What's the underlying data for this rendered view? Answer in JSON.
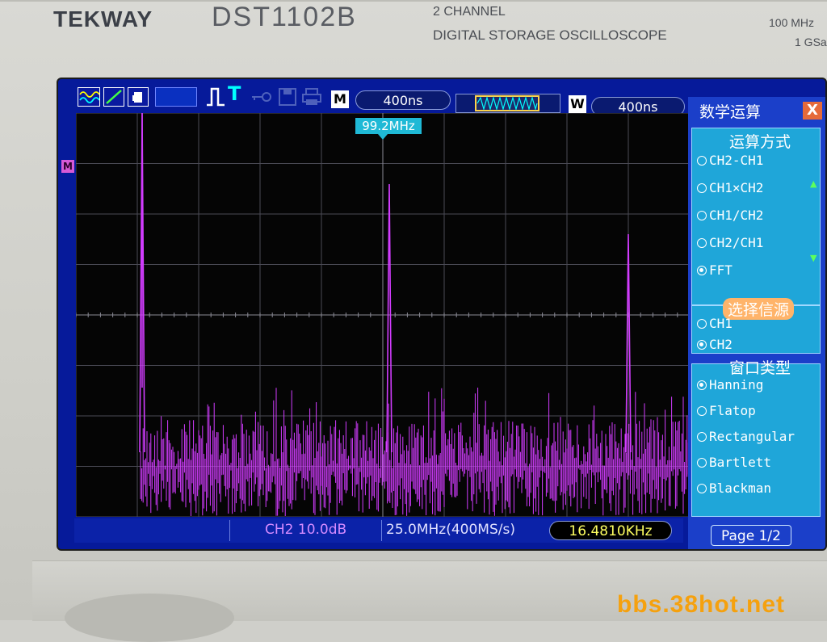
{
  "bezel": {
    "brand": "TEKWAY",
    "model": "DST1102B",
    "line1": "2 CHANNEL",
    "line2": "DIGITAL STORAGE OSCILLOSCOPE",
    "spec_bw": "100 MHz",
    "spec_rate": "1 GSa"
  },
  "watermark": "bbs.38hot.net",
  "toolbar": {
    "icons": [
      "waveform-icon",
      "line-icon",
      "hand-icon",
      "pulse-icon",
      "trigger-icon",
      "key-icon",
      "disk-icon",
      "printer-icon"
    ],
    "trigger_T": "T",
    "m_label": "M",
    "m_value": "400ns",
    "w_label": "W",
    "w_value": "400ns"
  },
  "plot": {
    "m_marker": "M",
    "cursor_freq": "99.2MHz",
    "trace_color": "#d23cff"
  },
  "status": {
    "channel_scale": "CH2 10.0dB",
    "span": "25.0MHz(400MS/s)",
    "freq_readout": "16.4810KHz"
  },
  "menu": {
    "title": "数学运算",
    "close": "X",
    "section_op": "运算方式",
    "ops": [
      "CH2-CH1",
      "CH1×CH2",
      "CH1/CH2",
      "CH2/CH1",
      "FFT"
    ],
    "op_selected_index": 4,
    "section_src": "选择信源",
    "sources": [
      "CH1",
      "CH2"
    ],
    "src_selected_index": 1,
    "section_win": "窗口类型",
    "windows": [
      "Hanning",
      "Flatop",
      "Rectangular",
      "Bartlett",
      "Blackman"
    ],
    "win_selected_index": 0,
    "page": "Page 1/2"
  },
  "colors": {
    "screen_bg": "#061a9a",
    "menu_panel": "#1fa6d9",
    "trace": "#d23cff",
    "freq_text": "#ffff60"
  }
}
